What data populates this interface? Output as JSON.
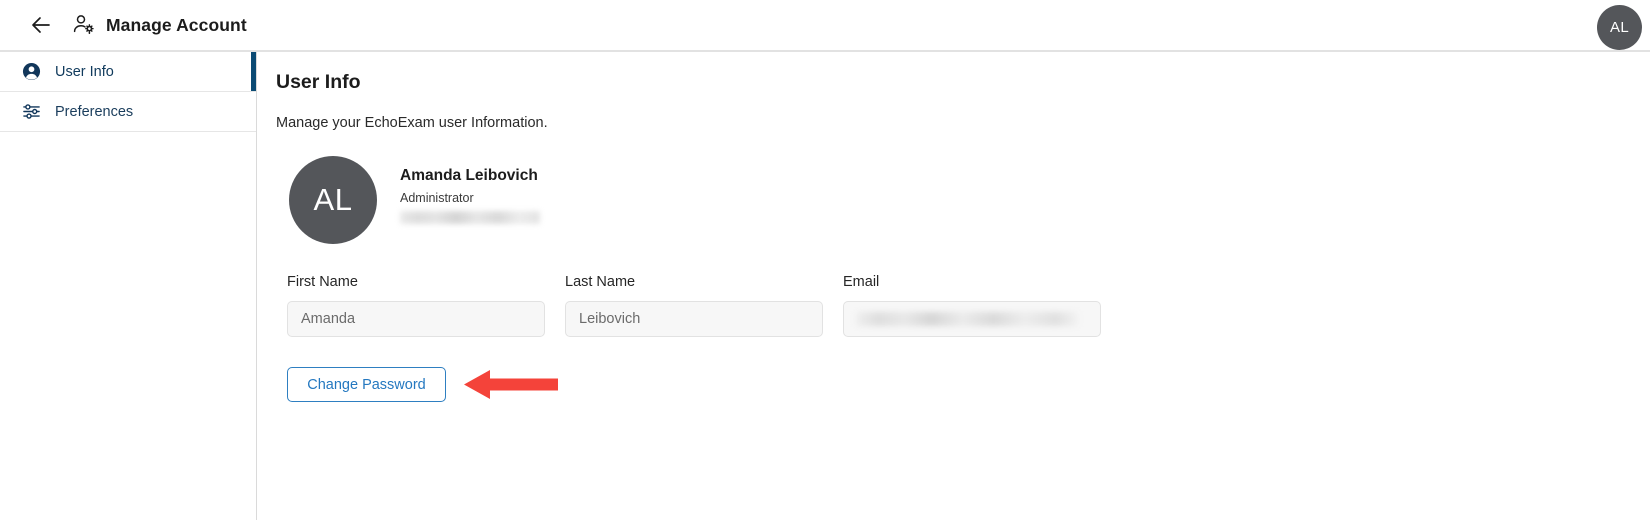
{
  "header": {
    "back_icon": "arrow-left-icon",
    "app_icon": "person-gear-icon",
    "title": "Manage Account",
    "avatar_initials": "AL"
  },
  "sidebar": {
    "items": [
      {
        "label": "User Info",
        "icon": "person-circle-icon",
        "active": true
      },
      {
        "label": "Preferences",
        "icon": "sliders-icon",
        "active": false
      }
    ]
  },
  "main": {
    "title": "User Info",
    "subtitle": "Manage your EchoExam user Information.",
    "profile": {
      "avatar_initials": "AL",
      "name": "Amanda Leibovich",
      "role": "Administrator",
      "email": ""
    },
    "form": {
      "fields": [
        {
          "label": "First Name",
          "value": "Amanda",
          "redacted": false
        },
        {
          "label": "Last Name",
          "value": "Leibovich",
          "redacted": false
        },
        {
          "label": "Email",
          "value": "",
          "redacted": true
        }
      ]
    },
    "change_password_label": "Change Password"
  },
  "annotation": {
    "arrow_color": "#f4433a",
    "arrow_direction": "left",
    "points_at": "Change Password"
  },
  "colors": {
    "accent_blue": "#2478c0",
    "active_nav_bar": "#0b4a73",
    "nav_text": "#1a3d5c",
    "avatar_bg": "#54565a",
    "header_border": "#e2e2e2",
    "input_bg": "#f7f7f7"
  }
}
